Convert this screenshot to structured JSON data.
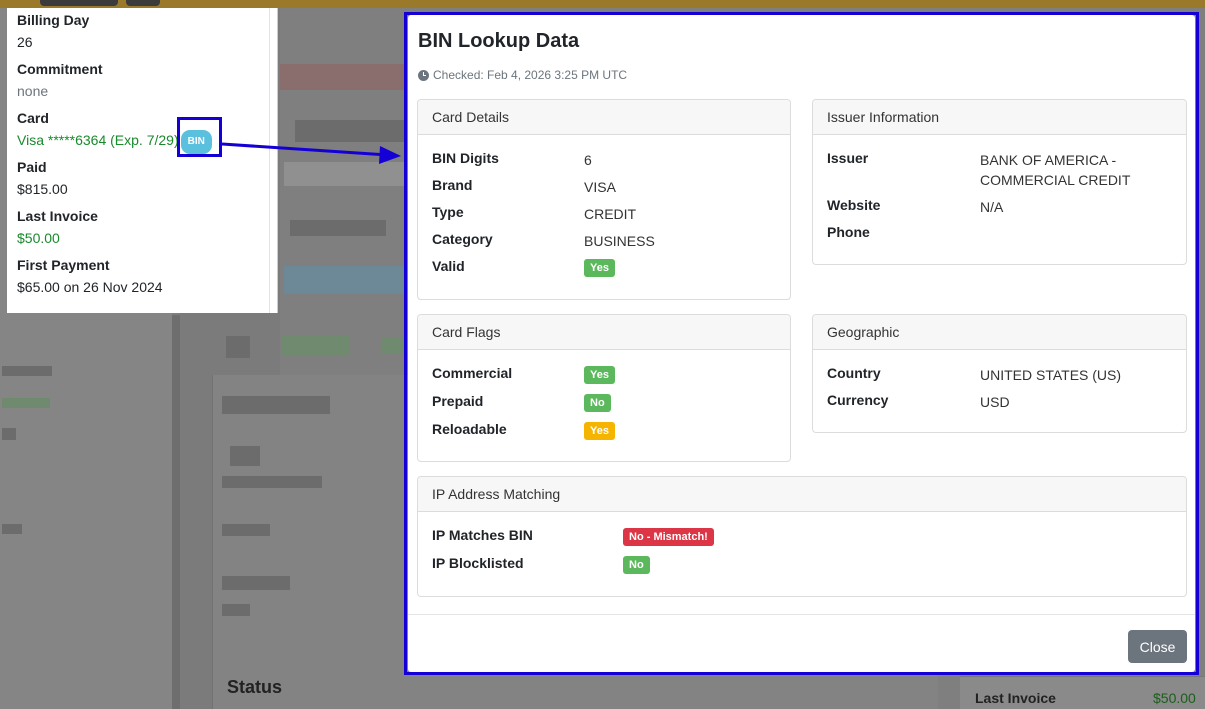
{
  "billing": {
    "billing_day_label": "Billing Day",
    "billing_day_value": "26",
    "commitment_label": "Commitment",
    "commitment_value": "none",
    "card_label": "Card",
    "card_value": "Visa *****6364 (Exp. 7/29)",
    "bin_button": "BIN",
    "paid_label": "Paid",
    "paid_value": "$815.00",
    "last_invoice_label": "Last Invoice",
    "last_invoice_value": "$50.00",
    "first_payment_label": "First Payment",
    "first_payment_value": "$65.00 on 26 Nov 2024"
  },
  "modal": {
    "title": "BIN Lookup Data",
    "checked": "Checked: Feb 4, 2026 3:25 PM UTC",
    "card_details": {
      "header": "Card Details",
      "rows": [
        {
          "key": "BIN Digits",
          "value": "6"
        },
        {
          "key": "Brand",
          "value": "VISA"
        },
        {
          "key": "Type",
          "value": "CREDIT"
        },
        {
          "key": "Category",
          "value": "BUSINESS"
        },
        {
          "key": "Valid",
          "value": "Yes"
        }
      ]
    },
    "issuer": {
      "header": "Issuer Information",
      "rows": [
        {
          "key": "Issuer",
          "value": "BANK OF AMERICA - COMMERCIAL CREDIT"
        },
        {
          "key": "Website",
          "value": "N/A"
        },
        {
          "key": "Phone",
          "value": ""
        }
      ]
    },
    "card_flags": {
      "header": "Card Flags",
      "rows": [
        {
          "key": "Commercial",
          "value": "Yes"
        },
        {
          "key": "Prepaid",
          "value": "No"
        },
        {
          "key": "Reloadable",
          "value": "Yes"
        }
      ]
    },
    "geographic": {
      "header": "Geographic",
      "rows": [
        {
          "key": "Country",
          "value": "UNITED STATES (US)"
        },
        {
          "key": "Currency",
          "value": "USD"
        }
      ]
    },
    "ip_matching": {
      "header": "IP Address Matching",
      "rows": [
        {
          "key": "IP Matches BIN",
          "value": "No - Mismatch!"
        },
        {
          "key": "IP Blocklisted",
          "value": "No"
        }
      ]
    },
    "close_label": "Close"
  },
  "background": {
    "status_heading": "Status",
    "last_invoice_label": "Last Invoice",
    "last_invoice_value": "$50.00"
  },
  "colors": {
    "highlight": "#1400d6",
    "badge_green": "#5cb85c",
    "badge_yellow": "#f5b400",
    "badge_red": "#dc3545",
    "bin_badge": "#5bc0de"
  }
}
